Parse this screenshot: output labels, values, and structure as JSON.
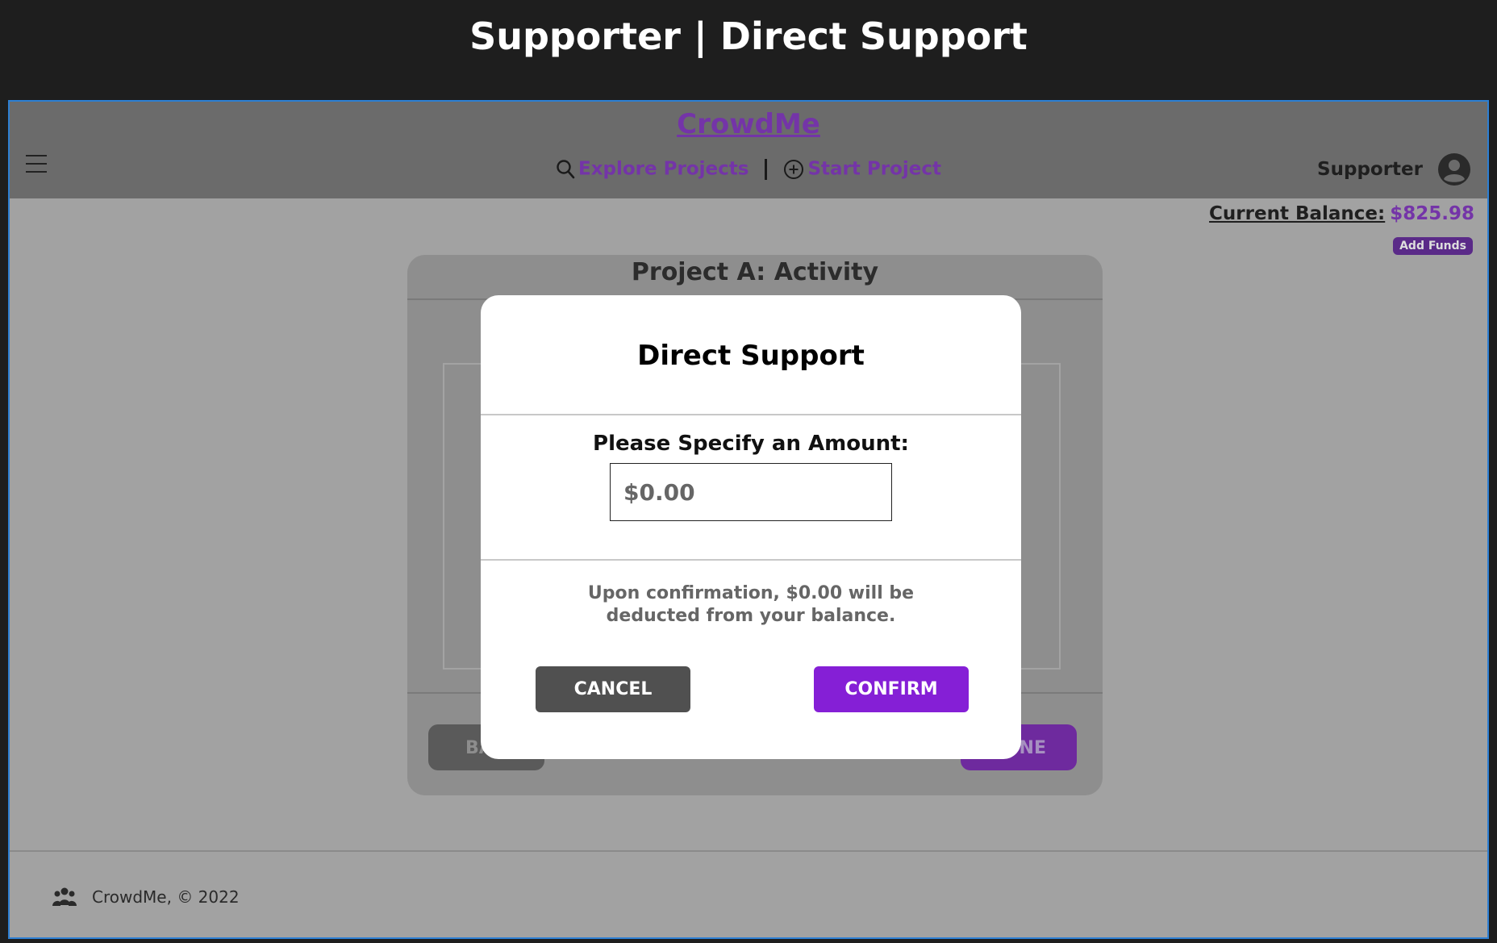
{
  "page_heading": "Supporter | Direct Support",
  "header": {
    "brand": "CrowdMe",
    "nav": {
      "explore_label": "Explore Projects",
      "start_label": "Start Project"
    },
    "user_role": "Supporter"
  },
  "balance": {
    "label": "Current Balance:",
    "value": "$825.98",
    "add_funds_label": "Add Funds"
  },
  "card": {
    "title": "Project A: Activity",
    "back_label": "BA",
    "done_label": "NE"
  },
  "modal": {
    "title": "Direct Support",
    "amount_label": "Please Specify an Amount:",
    "amount_placeholder": "$0.00",
    "note_line1": "Upon confirmation, $0.00 will be",
    "note_line2": "deducted from your balance.",
    "cancel_label": "CANCEL",
    "confirm_label": "CONFIRM"
  },
  "footer": {
    "text": "CrowdMe, © 2022"
  },
  "colors": {
    "accent": "#851fd6",
    "brand": "#7434a8",
    "cancel": "#505050"
  },
  "icons": [
    "menu-icon",
    "search-icon",
    "plus-circle-icon",
    "user-avatar-icon",
    "group-icon"
  ]
}
